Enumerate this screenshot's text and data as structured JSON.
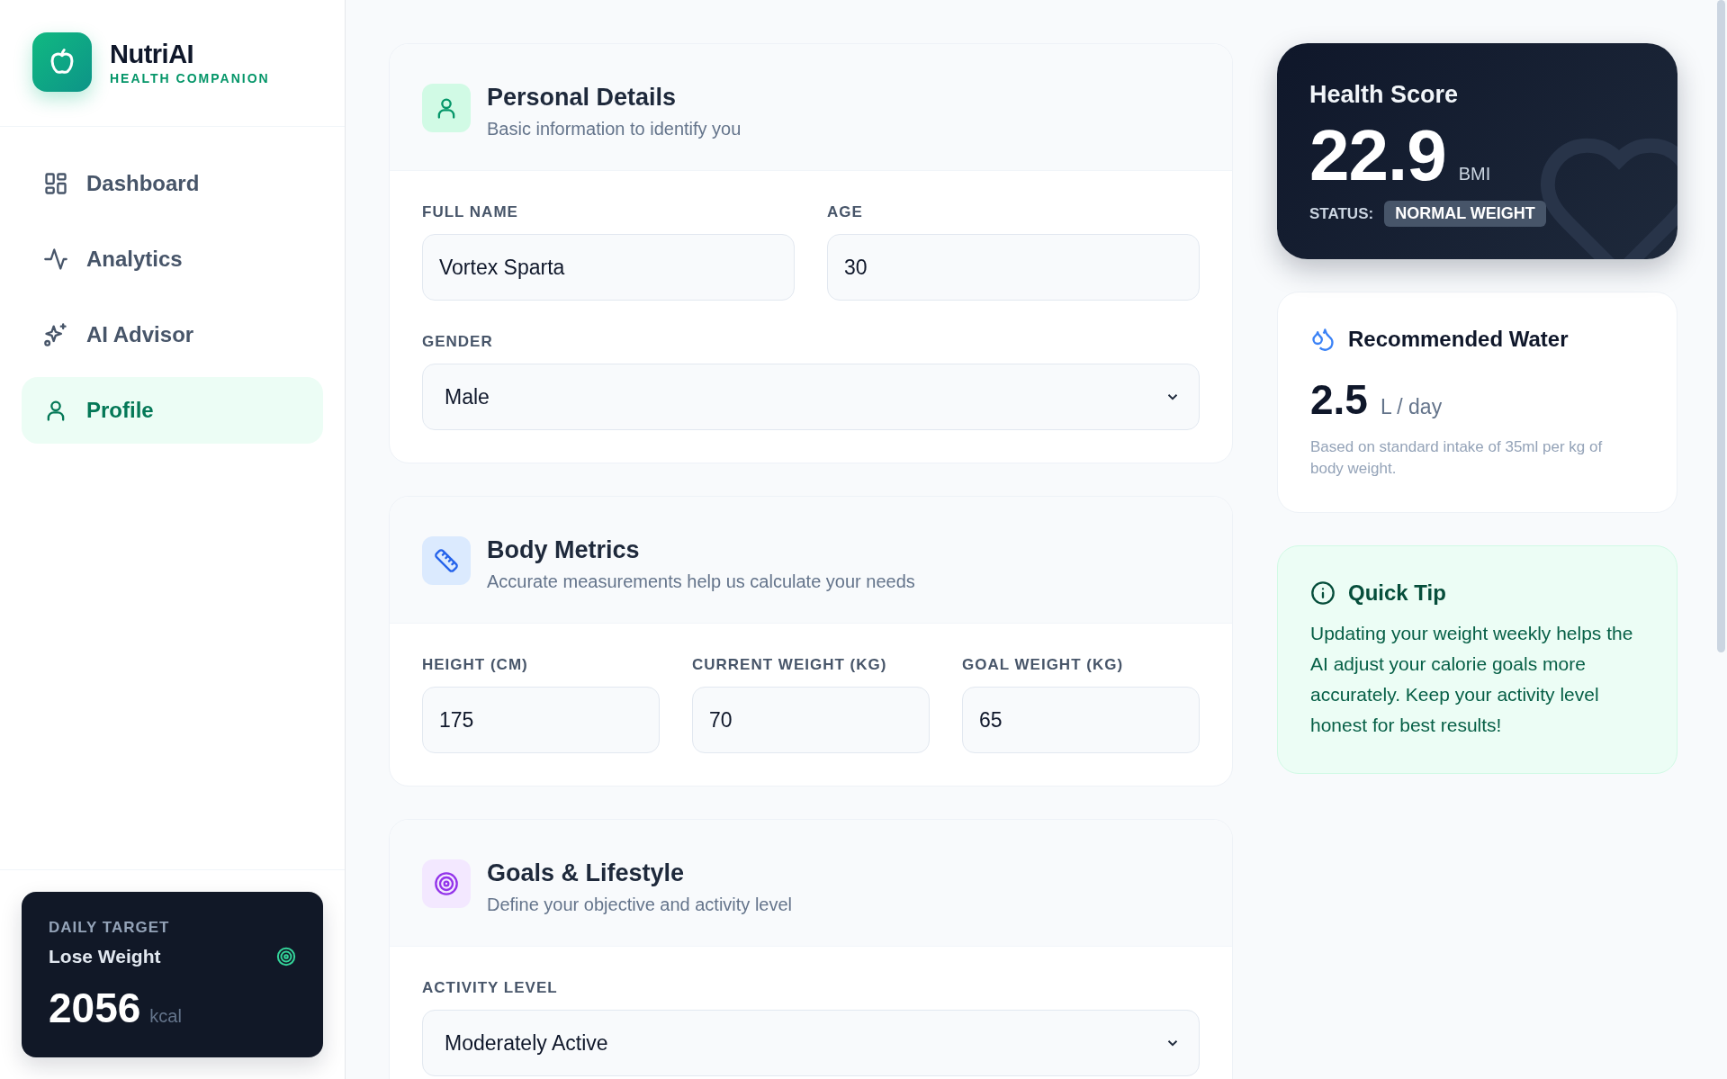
{
  "brand": {
    "name": "NutriAI",
    "tagline": "HEALTH COMPANION"
  },
  "nav": [
    {
      "label": "Dashboard",
      "kind": "grid",
      "selected": false
    },
    {
      "label": "Analytics",
      "kind": "pulse",
      "selected": false
    },
    {
      "label": "AI Advisor",
      "kind": "sparkle",
      "selected": false
    },
    {
      "label": "Profile",
      "kind": "person",
      "selected": true
    }
  ],
  "daily_target": {
    "label": "DAILY TARGET",
    "goal": "Lose Weight",
    "value": "2056",
    "unit": "kcal"
  },
  "sections": [
    {
      "kind": "person",
      "title": "Personal Details",
      "subtitle": "Basic information to identify you",
      "rows": [
        [
          {
            "label": "FULL NAME",
            "value": "Vortex Sparta",
            "kind": "input"
          },
          {
            "label": "AGE",
            "value": "30",
            "kind": "input"
          }
        ],
        [
          {
            "label": "GENDER",
            "value": "Male",
            "kind": "select"
          }
        ]
      ]
    },
    {
      "kind": "ruler",
      "title": "Body Metrics",
      "subtitle": "Accurate measurements help us calculate your needs",
      "rows": [
        [
          {
            "label": "HEIGHT (CM)",
            "value": "175",
            "kind": "input"
          },
          {
            "label": "CURRENT WEIGHT (KG)",
            "value": "70",
            "kind": "input"
          },
          {
            "label": "GOAL WEIGHT (KG)",
            "value": "65",
            "kind": "input"
          }
        ]
      ]
    },
    {
      "kind": "target",
      "title": "Goals & Lifestyle",
      "subtitle": "Define your objective and activity level",
      "rows": [
        [
          {
            "label": "ACTIVITY LEVEL",
            "value": "Moderately Active",
            "kind": "select"
          }
        ]
      ]
    }
  ],
  "health_score": {
    "title": "Health Score",
    "value": "22.9",
    "unit": "BMI",
    "status_label": "STATUS:",
    "status": "NORMAL WEIGHT"
  },
  "water": {
    "title": "Recommended Water",
    "value": "2.5",
    "unit": "L / day",
    "note": "Based on standard intake of 35ml per kg of body weight."
  },
  "tip": {
    "title": "Quick Tip",
    "text": "Updating your weight weekly helps the AI adjust your calorie goals more accurately. Keep your activity level honest for best results!"
  }
}
